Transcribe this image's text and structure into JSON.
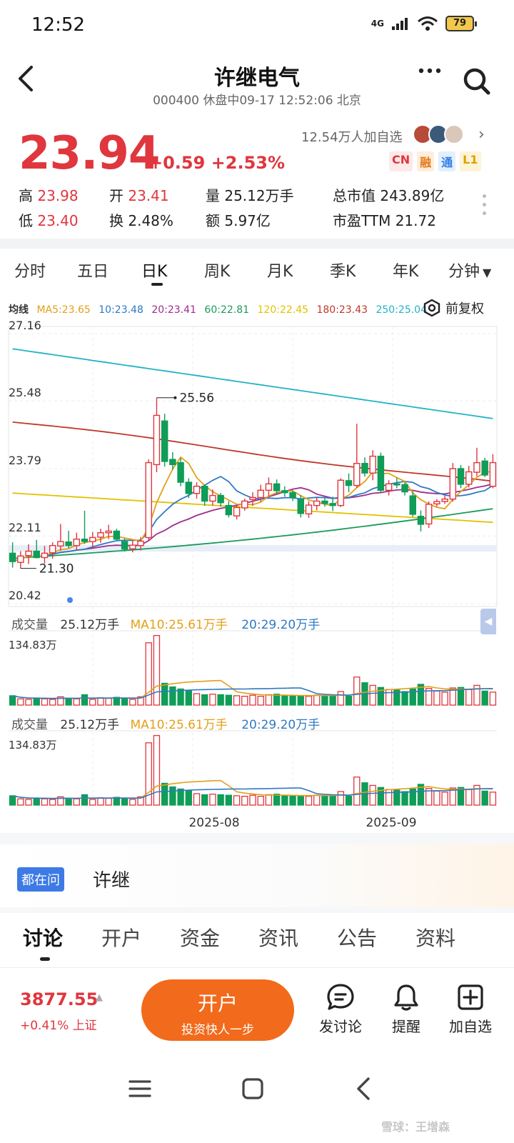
{
  "status_bar": {
    "time": "12:52",
    "network": "4G",
    "battery": "79"
  },
  "header": {
    "title": "许继电气",
    "subtitle": "000400 休盘中09-17 12:52:06 北京"
  },
  "quote": {
    "price": "23.94",
    "change": "+0.59 +2.53%",
    "followers": "12.54万人加自选",
    "tags": [
      {
        "text": "CN",
        "color": "#e0363e",
        "bg": "#fde9ea"
      },
      {
        "text": "融",
        "color": "#e67a1a",
        "bg": "#fdeedd"
      },
      {
        "text": "通",
        "color": "#2f7fe6",
        "bg": "#e4effd"
      },
      {
        "text": "L1",
        "color": "#e0a100",
        "bg": "#fdf4d8"
      }
    ],
    "stats": {
      "high_label": "高",
      "high": "23.98",
      "open_label": "开",
      "open": "23.41",
      "volume_label": "量",
      "volume": "25.12万手",
      "mktcap_label": "总市值",
      "mktcap": "243.89亿",
      "low_label": "低",
      "low": "23.40",
      "turnover_label": "换",
      "turnover": "2.48%",
      "amount_label": "额",
      "amount": "5.97亿",
      "pe_label": "市盈TTM",
      "pe": "21.72"
    }
  },
  "period_tabs": [
    "分时",
    "五日",
    "日K",
    "周K",
    "月K",
    "季K",
    "年K",
    "分钟"
  ],
  "active_period": "日K",
  "ma_row": {
    "label": "均线",
    "items": [
      {
        "text": "MA5:23.65",
        "color": "#e3a018"
      },
      {
        "text": "10:23.48",
        "color": "#2f79c4"
      },
      {
        "text": "20:23.41",
        "color": "#a02d8a"
      },
      {
        "text": "60:22.81",
        "color": "#1c9a5c"
      },
      {
        "text": "120:22.45",
        "color": "#e2c200"
      },
      {
        "text": "180:23.43",
        "color": "#c0392b"
      },
      {
        "text": "250:25.04",
        "color": "#22b3c6"
      }
    ],
    "adjust_label": "前复权"
  },
  "colors": {
    "up": "#e0363e",
    "down": "#0f9d58"
  },
  "chart_data": {
    "type": "candlestick",
    "y_ticks": [
      "27.16",
      "25.48",
      "23.79",
      "22.11",
      "20.42"
    ],
    "ylim": [
      20.42,
      27.16
    ],
    "x_tick_labels": [
      "2025-08",
      "2025-09"
    ],
    "annotations": {
      "high_marker": "25.56",
      "low_marker": "21.30"
    },
    "candles": [
      {
        "o": 21.68,
        "h": 21.95,
        "l": 21.32,
        "c": 21.47
      },
      {
        "o": 21.45,
        "h": 21.73,
        "l": 21.3,
        "c": 21.61
      },
      {
        "o": 21.62,
        "h": 21.9,
        "l": 21.41,
        "c": 21.73
      },
      {
        "o": 21.73,
        "h": 22.01,
        "l": 21.55,
        "c": 21.57
      },
      {
        "o": 21.57,
        "h": 21.86,
        "l": 21.42,
        "c": 21.68
      },
      {
        "o": 21.69,
        "h": 21.95,
        "l": 21.54,
        "c": 21.87
      },
      {
        "o": 21.86,
        "h": 22.41,
        "l": 21.74,
        "c": 21.97
      },
      {
        "o": 21.96,
        "h": 22.24,
        "l": 21.81,
        "c": 21.87
      },
      {
        "o": 21.87,
        "h": 22.19,
        "l": 21.75,
        "c": 22.03
      },
      {
        "o": 22.03,
        "h": 22.74,
        "l": 21.91,
        "c": 21.97
      },
      {
        "o": 21.97,
        "h": 22.21,
        "l": 21.81,
        "c": 22.07
      },
      {
        "o": 22.08,
        "h": 22.29,
        "l": 21.94,
        "c": 22.19
      },
      {
        "o": 22.19,
        "h": 22.39,
        "l": 22.03,
        "c": 22.23
      },
      {
        "o": 22.23,
        "h": 22.29,
        "l": 21.98,
        "c": 22.03
      },
      {
        "o": 21.97,
        "h": 22.05,
        "l": 21.72,
        "c": 21.78
      },
      {
        "o": 21.79,
        "h": 22.0,
        "l": 21.7,
        "c": 21.88
      },
      {
        "o": 21.87,
        "h": 22.08,
        "l": 21.75,
        "c": 21.98
      },
      {
        "o": 22.07,
        "h": 24.02,
        "l": 22.0,
        "c": 23.94
      },
      {
        "o": 23.89,
        "h": 25.56,
        "l": 23.7,
        "c": 25.12
      },
      {
        "o": 24.98,
        "h": 25.16,
        "l": 23.84,
        "c": 23.97
      },
      {
        "o": 24.02,
        "h": 24.2,
        "l": 23.76,
        "c": 23.89
      },
      {
        "o": 23.94,
        "h": 24.06,
        "l": 23.35,
        "c": 23.45
      },
      {
        "o": 23.45,
        "h": 23.55,
        "l": 23.06,
        "c": 23.17
      },
      {
        "o": 23.17,
        "h": 23.45,
        "l": 23.04,
        "c": 23.35
      },
      {
        "o": 23.35,
        "h": 23.4,
        "l": 22.86,
        "c": 22.98
      },
      {
        "o": 22.98,
        "h": 23.27,
        "l": 22.87,
        "c": 23.12
      },
      {
        "o": 23.12,
        "h": 23.18,
        "l": 22.84,
        "c": 22.94
      },
      {
        "o": 22.87,
        "h": 22.98,
        "l": 22.57,
        "c": 22.64
      },
      {
        "o": 22.61,
        "h": 22.87,
        "l": 22.52,
        "c": 22.82
      },
      {
        "o": 22.81,
        "h": 23.04,
        "l": 22.74,
        "c": 22.98
      },
      {
        "o": 23.02,
        "h": 23.2,
        "l": 22.86,
        "c": 23.07
      },
      {
        "o": 23.07,
        "h": 23.39,
        "l": 22.96,
        "c": 23.25
      },
      {
        "o": 23.25,
        "h": 23.57,
        "l": 23.1,
        "c": 23.41
      },
      {
        "o": 23.41,
        "h": 23.52,
        "l": 23.15,
        "c": 23.24
      },
      {
        "o": 23.24,
        "h": 23.35,
        "l": 23.09,
        "c": 23.19
      },
      {
        "o": 23.19,
        "h": 23.25,
        "l": 22.98,
        "c": 23.07
      },
      {
        "o": 23.02,
        "h": 23.13,
        "l": 22.57,
        "c": 22.67
      },
      {
        "o": 22.66,
        "h": 22.98,
        "l": 22.56,
        "c": 22.88
      },
      {
        "o": 22.87,
        "h": 23.06,
        "l": 22.75,
        "c": 22.98
      },
      {
        "o": 22.98,
        "h": 23.06,
        "l": 22.84,
        "c": 22.92
      },
      {
        "o": 22.92,
        "h": 23.09,
        "l": 22.73,
        "c": 22.87
      },
      {
        "o": 22.87,
        "h": 23.55,
        "l": 22.83,
        "c": 23.5
      },
      {
        "o": 23.49,
        "h": 23.67,
        "l": 23.2,
        "c": 23.37
      },
      {
        "o": 23.37,
        "h": 24.91,
        "l": 23.31,
        "c": 23.92
      },
      {
        "o": 23.92,
        "h": 24.07,
        "l": 23.59,
        "c": 23.68
      },
      {
        "o": 23.68,
        "h": 24.25,
        "l": 23.5,
        "c": 24.1
      },
      {
        "o": 24.1,
        "h": 24.19,
        "l": 23.2,
        "c": 23.25
      },
      {
        "o": 23.25,
        "h": 23.5,
        "l": 23.12,
        "c": 23.41
      },
      {
        "o": 23.41,
        "h": 23.56,
        "l": 23.3,
        "c": 23.39
      },
      {
        "o": 23.39,
        "h": 23.45,
        "l": 23.12,
        "c": 23.21
      },
      {
        "o": 23.11,
        "h": 23.22,
        "l": 22.59,
        "c": 22.65
      },
      {
        "o": 22.6,
        "h": 22.75,
        "l": 22.22,
        "c": 22.4
      },
      {
        "o": 22.41,
        "h": 22.97,
        "l": 22.31,
        "c": 22.9
      },
      {
        "o": 22.91,
        "h": 23.03,
        "l": 22.84,
        "c": 22.97
      },
      {
        "o": 22.97,
        "h": 23.11,
        "l": 22.91,
        "c": 23.03
      },
      {
        "o": 23.03,
        "h": 23.93,
        "l": 22.97,
        "c": 23.79
      },
      {
        "o": 23.79,
        "h": 23.88,
        "l": 23.3,
        "c": 23.4
      },
      {
        "o": 23.4,
        "h": 23.86,
        "l": 23.32,
        "c": 23.71
      },
      {
        "o": 23.7,
        "h": 24.31,
        "l": 23.6,
        "c": 23.94
      },
      {
        "o": 23.98,
        "h": 24.06,
        "l": 23.58,
        "c": 23.63
      },
      {
        "o": 23.35,
        "h": 24.15,
        "l": 23.3,
        "c": 23.94
      }
    ],
    "volume": {
      "header_label": "成交量",
      "value_text": "25.12万手",
      "ma10_text": "MA10:25.61万手",
      "ma20_text": "20:29.20万手",
      "max_label": "134.83万",
      "values": [
        18,
        12,
        11,
        13,
        12,
        11,
        16,
        13,
        12,
        20,
        11,
        14,
        13,
        15,
        12,
        11,
        16,
        120,
        134,
        42,
        35,
        31,
        28,
        22,
        20,
        21,
        20,
        19,
        18,
        17,
        19,
        17,
        20,
        21,
        19,
        18,
        17,
        17,
        19,
        18,
        18,
        26,
        17,
        54,
        43,
        38,
        34,
        30,
        29,
        26,
        31,
        40,
        32,
        27,
        25,
        33,
        34,
        30,
        38,
        27,
        25
      ]
    }
  },
  "ask": {
    "badge": "都在问",
    "text": "许继"
  },
  "content_tabs": [
    "讨论",
    "开户",
    "资金",
    "资讯",
    "公告",
    "资料"
  ],
  "active_content_tab": "讨论",
  "action_bar": {
    "index_value": "3877.55",
    "index_change": "+0.41% 上证",
    "open_title": "开户",
    "open_sub": "投资快人一步",
    "discuss": "发讨论",
    "remind": "提醒",
    "add": "加自选"
  },
  "watermark": "雪球：王增森"
}
